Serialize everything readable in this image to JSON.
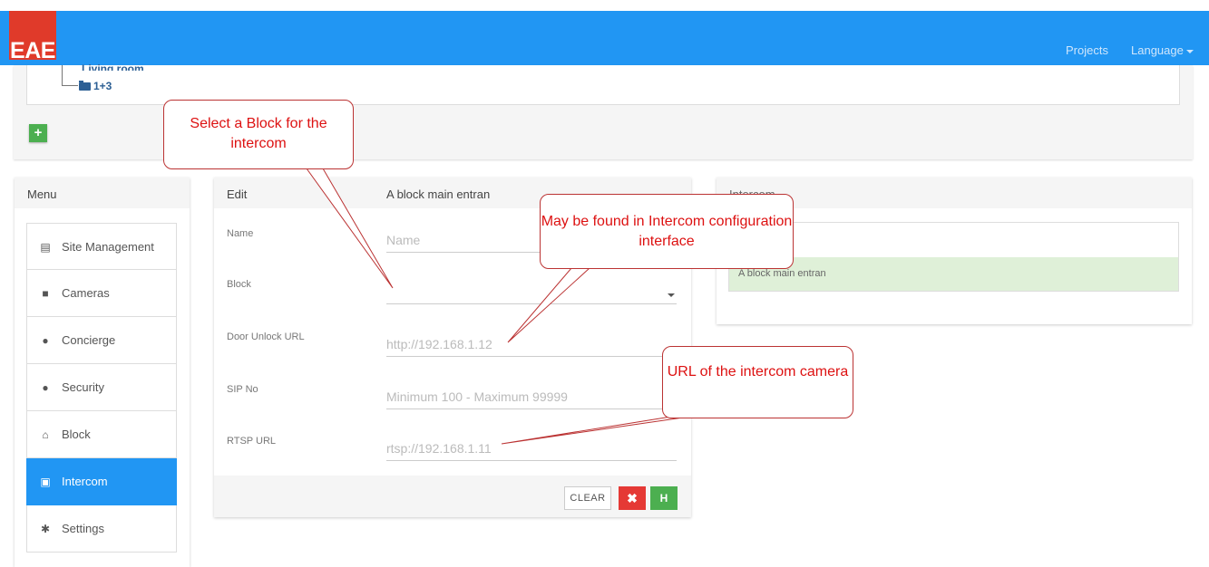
{
  "navbar": {
    "logo": "EAE",
    "projects": "Projects",
    "language": "Language"
  },
  "tree": {
    "parent_label": "Living room",
    "item_label": "1+3",
    "add_button": "+"
  },
  "menu": {
    "title": "Menu",
    "items": [
      {
        "label": "Site Management",
        "icon": "list-icon"
      },
      {
        "label": "Cameras",
        "icon": "video-camera-icon"
      },
      {
        "label": "Concierge",
        "icon": "user-icon"
      },
      {
        "label": "Security",
        "icon": "user-icon"
      },
      {
        "label": "Block",
        "icon": "home-icon"
      },
      {
        "label": "Intercom",
        "icon": "intercom-icon",
        "active": true
      },
      {
        "label": "Settings",
        "icon": "gear-icon"
      }
    ]
  },
  "edit": {
    "title": "Edit",
    "subtitle": "A block main entran",
    "fields": {
      "name": {
        "label": "Name",
        "placeholder": "Name"
      },
      "block": {
        "label": "Block",
        "value": ""
      },
      "door_unlock_url": {
        "label": "Door Unlock URL",
        "placeholder": "http://192.168.1.12"
      },
      "sip_no": {
        "label": "SIP No",
        "placeholder": "Minimum 100 - Maximum 99999"
      },
      "rtsp_url": {
        "label": "RTSP URL",
        "placeholder": "rtsp://192.168.1.11"
      }
    },
    "clear_button": "CLEAR",
    "cancel_icon": "✖",
    "save_icon": "H"
  },
  "intercom": {
    "title": "Intercom",
    "rows": [
      "A block main entran"
    ]
  },
  "callouts": {
    "block": "Select a Block for the intercom",
    "config": "May be found in Intercom configuration interface",
    "camera": "URL of the intercom camera"
  },
  "colors": {
    "primary": "#2196f3",
    "logo": "#e03a2a",
    "success": "#4caf50",
    "danger": "#e53935",
    "callout_text": "#dd1111"
  }
}
